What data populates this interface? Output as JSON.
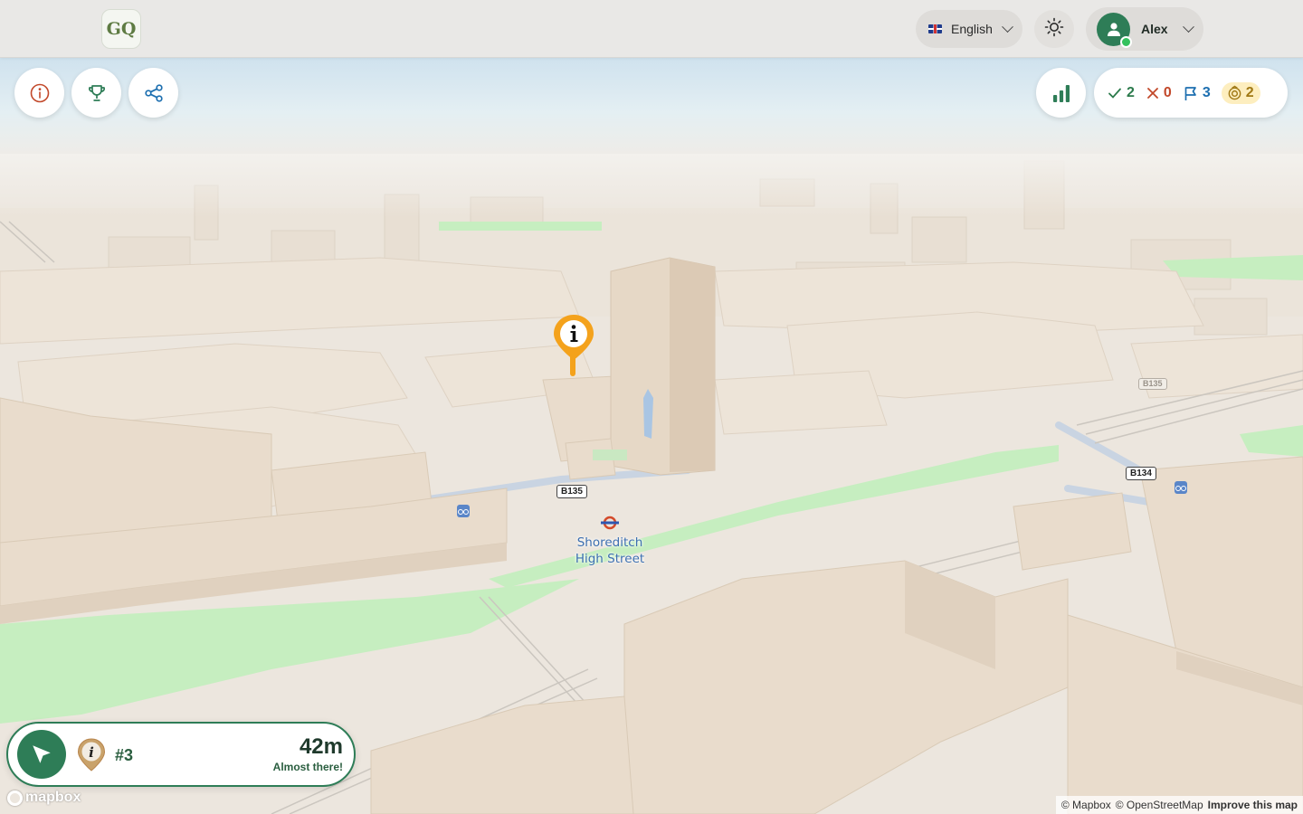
{
  "app": {
    "logo_text": "GQ"
  },
  "header": {
    "language": {
      "label": "English",
      "icon": "uk-flag-icon"
    },
    "theme_icon": "sun-icon",
    "user": {
      "name": "Alex",
      "status_color": "#35c15e"
    }
  },
  "toolbar": {
    "info_icon": "info-icon",
    "leaderboard_icon": "trophy-icon",
    "share_icon": "share-icon",
    "stats_icon": "bar-chart-icon"
  },
  "score": {
    "correct": "2",
    "wrong": "0",
    "flags": "3",
    "coins": "2"
  },
  "map": {
    "station_line1": "Shoreditch",
    "station_line2": "High Street",
    "road_b135": "B135",
    "road_b135_far": "B135",
    "road_b134": "B134",
    "pin_icon": "info-pin-icon",
    "attribution": {
      "mapbox": "© Mapbox",
      "osm": "© OpenStreetMap",
      "improve": "Improve this map"
    },
    "logo_text": "mapbox"
  },
  "navigation": {
    "poi_number": "#3",
    "distance": "42m",
    "status": "Almost there!"
  },
  "colors": {
    "brand_green": "#2e7d57",
    "coin_bg": "#fdeebf",
    "pin_orange": "#f4a21c",
    "park_green": "#c7efc2",
    "building": "#ece3d8"
  }
}
